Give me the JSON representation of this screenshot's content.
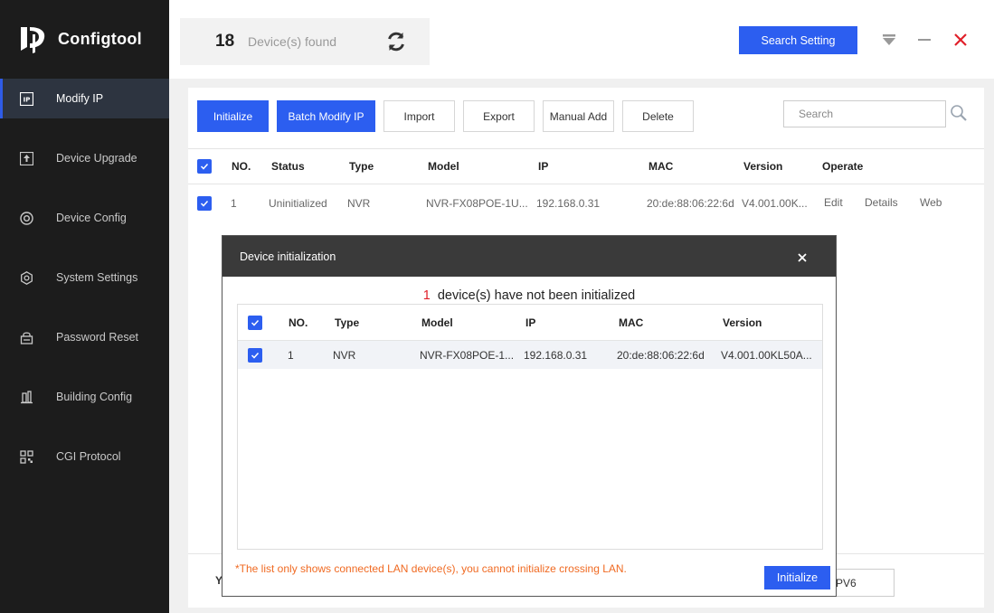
{
  "app": {
    "title": "Configtool"
  },
  "sidebar": {
    "items": [
      {
        "label": "Modify IP",
        "icon": "ip-icon",
        "active": true
      },
      {
        "label": "Device Upgrade",
        "icon": "upgrade-icon"
      },
      {
        "label": "Device Config",
        "icon": "config-icon"
      },
      {
        "label": "System Settings",
        "icon": "settings-icon"
      },
      {
        "label": "Password Reset",
        "icon": "password-reset-icon"
      },
      {
        "label": "Building Config",
        "icon": "building-icon"
      },
      {
        "label": "CGI Protocol",
        "icon": "cgi-icon"
      }
    ]
  },
  "header": {
    "device_count": "18",
    "device_label": "Device(s) found",
    "search_setting_label": "Search Setting"
  },
  "toolbar": {
    "initialize_label": "Initialize",
    "batch_modify_label": "Batch Modify IP",
    "import_label": "Import",
    "export_label": "Export",
    "manual_add_label": "Manual Add",
    "delete_label": "Delete",
    "search_placeholder": "Search"
  },
  "table": {
    "columns": [
      "NO.",
      "Status",
      "Type",
      "Model",
      "IP",
      "MAC",
      "Version",
      "Operate"
    ],
    "rows": [
      {
        "no": "1",
        "status": "Uninitialized",
        "type": "NVR",
        "model": "NVR-FX08POE-1U...",
        "ip": "192.168.0.31",
        "mac": "20:de:88:06:22:6d",
        "version": "V4.001.00K...",
        "ops": [
          "Edit",
          "Details",
          "Web"
        ]
      }
    ]
  },
  "bottom": {
    "left_fragment": "Y",
    "ipv6_fragment": "PV6"
  },
  "modal": {
    "title": "Device initialization",
    "count": "1",
    "message": "device(s) have not been initialized",
    "columns": [
      "NO.",
      "Type",
      "Model",
      "IP",
      "MAC",
      "Version"
    ],
    "rows": [
      {
        "no": "1",
        "type": "NVR",
        "model": "NVR-FX08POE-1...",
        "ip": "192.168.0.31",
        "mac": "20:de:88:06:22:6d",
        "version": "V4.001.00KL50A..."
      }
    ],
    "note": "*The list only shows connected LAN device(s), you cannot initialize crossing LAN.",
    "initialize_label": "Initialize"
  },
  "colors": {
    "accent": "#2c5ef0",
    "sidebar_bg": "#1c1c1c",
    "close_red": "#e0202a",
    "note_orange": "#f06a22"
  }
}
